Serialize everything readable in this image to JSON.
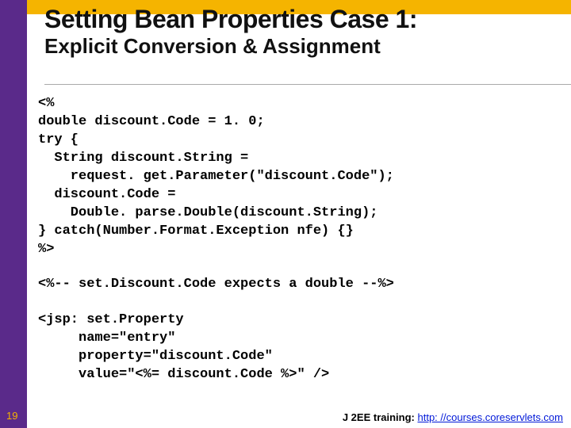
{
  "title": {
    "line1": "Setting Bean Properties Case 1:",
    "line2": "Explicit Conversion & Assignment"
  },
  "code": {
    "block1": "<%\ndouble discount.Code = 1. 0;\ntry {\n  String discount.String =\n    request. get.Parameter(\"discount.Code\");\n  discount.Code =\n    Double. parse.Double(discount.String);\n} catch(Number.Format.Exception nfe) {}\n%>",
    "block2": "<%-- set.Discount.Code expects a double --%>",
    "block3": "<jsp: set.Property\n     name=\"entry\"\n     property=\"discount.Code\"\n     value=\"<%= discount.Code %>\" />"
  },
  "page_number": "19",
  "footer": {
    "label": "J 2EE training: ",
    "url_text": "http: //courses.coreservlets.com"
  }
}
